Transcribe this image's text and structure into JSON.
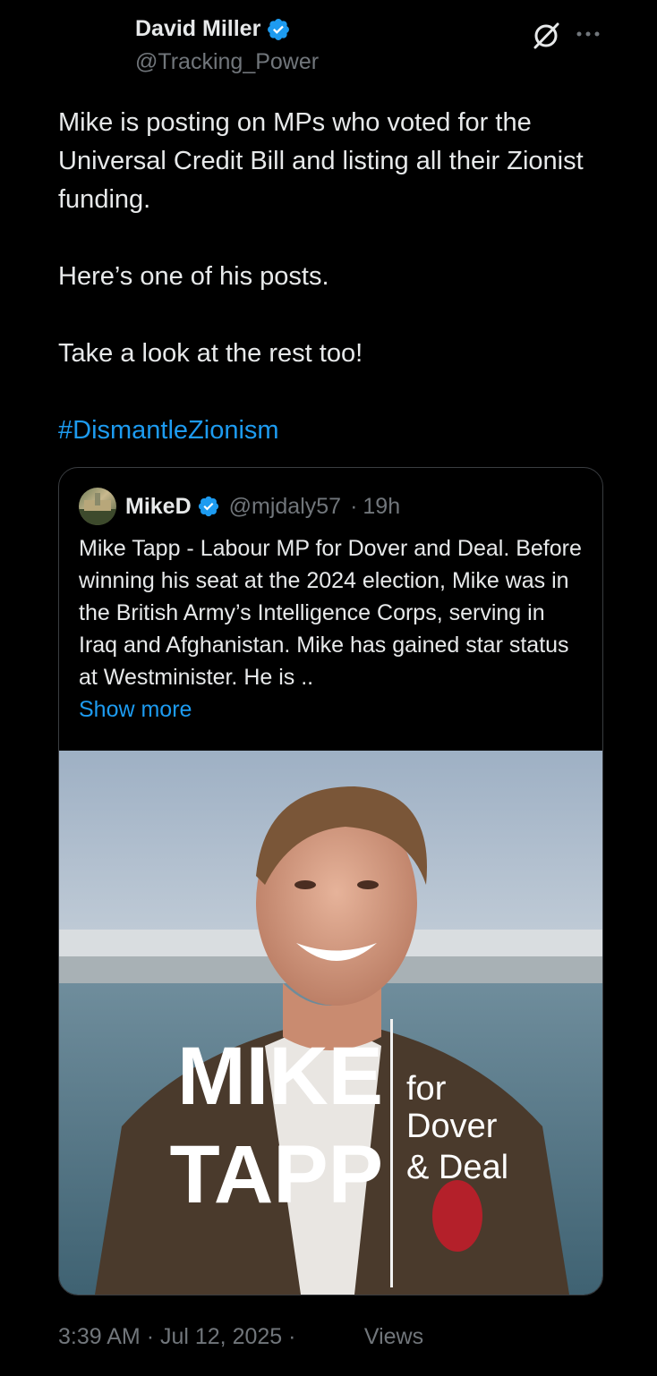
{
  "author": {
    "name": "David Miller",
    "handle": "@Tracking_Power",
    "verified": true
  },
  "tweet": {
    "paragraphs": [
      "Mike is posting on MPs who voted for the Universal Credit Bill and listing all their Zionist funding.",
      "Here’s one of his posts.",
      "Take a look at the rest too!"
    ],
    "hashtag": "#DismantleZionism"
  },
  "quote": {
    "name": "MikeD",
    "handle": "@mjdaly57",
    "separator": "·",
    "time": "19h",
    "verified": true,
    "text": "Mike Tapp - Labour MP for Dover and Deal. Before winning his seat at the 2024 election, Mike was in the British Army’s Intelligence Corps, serving in Iraq and Afghanistan. Mike has gained star status at Westminister. He is ..",
    "show_more": "Show more",
    "image": {
      "overlay_name_line1": "MIKE",
      "overlay_name_line2": "TAPP",
      "overlay_for": "for",
      "overlay_place1": "Dover",
      "overlay_place2": "& Deal"
    }
  },
  "footer": {
    "time": "3:39 AM",
    "date": "Jul 12, 2025",
    "separator": "·",
    "views_label": "Views"
  },
  "colors": {
    "background": "#000000",
    "text": "#e7e9ea",
    "muted": "#71767b",
    "accent": "#1d9bf0",
    "border": "#3a3d41"
  },
  "icons": [
    "verified-badge-icon",
    "grok-icon",
    "more-icon"
  ]
}
